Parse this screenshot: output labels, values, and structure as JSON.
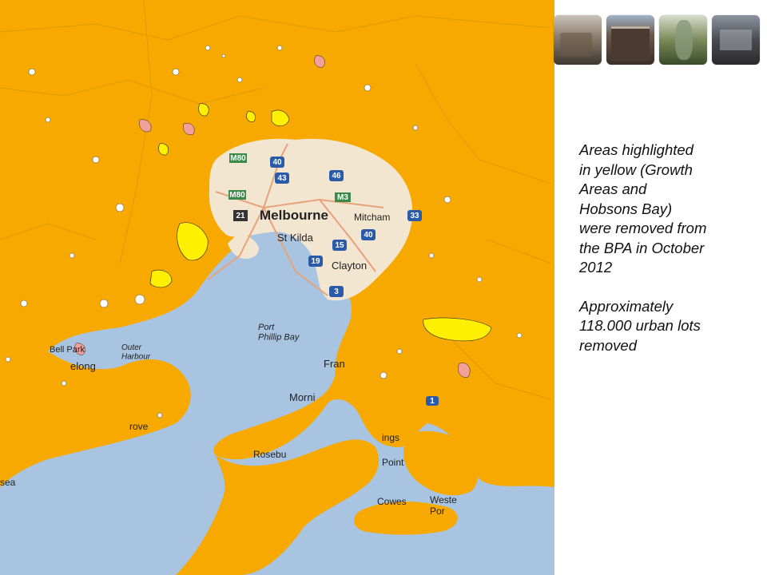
{
  "caption": {
    "paragraph1": "Areas highlighted\nin yellow (Growth\nAreas and\nHobsons Bay)\nwere removed from\nthe BPA in October\n2012",
    "paragraph2": "Approximately\n118.000 urban lots\nremoved"
  },
  "map": {
    "labels": {
      "melbourne": "Melbourne",
      "st_kilda": "St Kilda",
      "mitcham": "Mitcham",
      "clayton": "Clayton",
      "port_phillip_bay": "Port\nPhillip Bay",
      "outer_harbour": "Outer\nHarbour",
      "frankston": "Fran",
      "mornington": "Morni",
      "rosebud": "Rosebu",
      "geelong": "elong",
      "bell_park": "Bell Park",
      "hastings": "ings",
      "point": "Point",
      "cowes": "Cowes",
      "western": "Weste\nPor",
      "grove": "rove",
      "sea": "sea"
    },
    "roads": [
      "M80",
      "40",
      "43",
      "46",
      "M80",
      "M3",
      "21",
      "33",
      "40",
      "15",
      "19",
      "3",
      "1"
    ],
    "colors": {
      "background": "#f7a900",
      "water": "#a8c4e0",
      "urban": "#f2e6d0",
      "removed_highlight": "#ffef00",
      "pink": "#f2a09a"
    }
  },
  "photos": [
    "photo-street-scene",
    "photo-townhouses",
    "photo-courtyard-trees",
    "photo-modern-housing"
  ]
}
